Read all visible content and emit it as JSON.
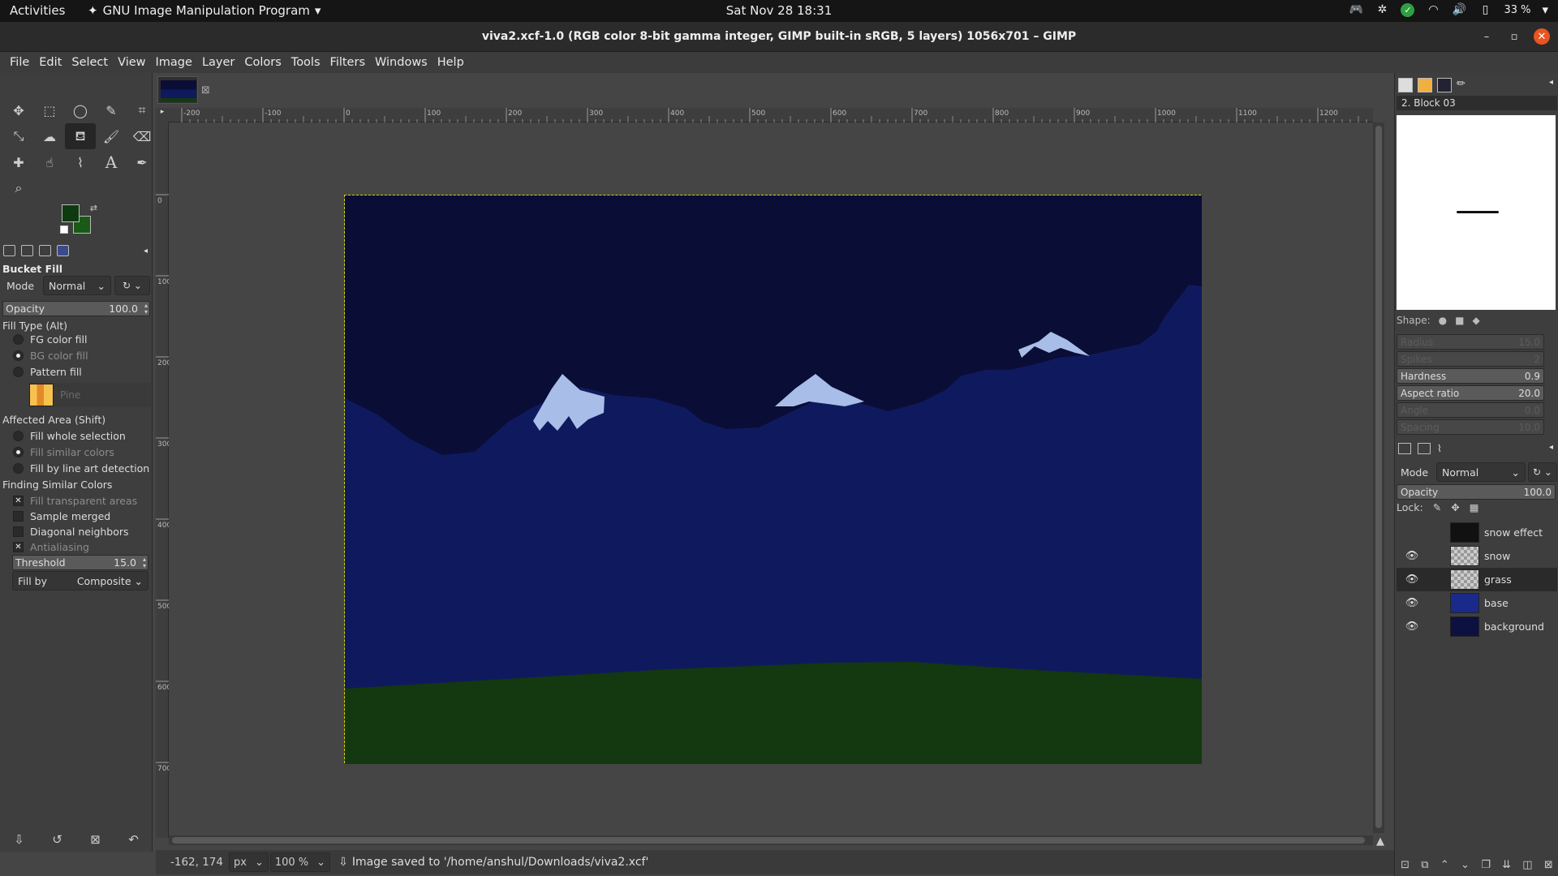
{
  "topbar": {
    "activities": "Activities",
    "app_name": "GNU Image Manipulation Program",
    "clock": "Sat Nov 28  18:31",
    "battery": "33 %"
  },
  "window": {
    "title": "viva2.xcf-1.0 (RGB color 8-bit gamma integer, GIMP built-in sRGB, 5 layers) 1056x701 – GIMP"
  },
  "menu": [
    "File",
    "Edit",
    "Select",
    "View",
    "Image",
    "Layer",
    "Colors",
    "Tools",
    "Filters",
    "Windows",
    "Help"
  ],
  "toolbox": {
    "tools": [
      "move-icon",
      "rect-select-icon",
      "lasso-icon",
      "fuzzy-select-icon",
      "crop-icon",
      "transform-icon",
      "warp-icon",
      "bucket-fill-icon",
      "paintbrush-icon",
      "eraser-icon",
      "heal-icon",
      "smudge-icon",
      "paths-icon",
      "text-icon",
      "color-picker-icon",
      "zoom-icon"
    ],
    "fg_color": "#0e3a10",
    "bg_color": "#1a5a18"
  },
  "tool_options": {
    "title": "Bucket Fill",
    "mode_label": "Mode",
    "mode_value": "Normal",
    "opacity_label": "Opacity",
    "opacity_value": "100.0",
    "fill_type_label": "Fill Type  (Alt)",
    "fill_types": [
      "FG color fill",
      "BG color fill",
      "Pattern fill"
    ],
    "pattern_name": "Pine",
    "affected_area_label": "Affected Area  (Shift)",
    "affected_areas": [
      "Fill whole selection",
      "Fill similar colors",
      "Fill by line art detection"
    ],
    "finding_label": "Finding Similar Colors",
    "checks": [
      "Fill transparent areas",
      "Sample merged",
      "Diagonal neighbors",
      "Antialiasing"
    ],
    "threshold_label": "Threshold",
    "threshold_value": "15.0",
    "fill_by_label": "Fill by",
    "fill_by_value": "Composite"
  },
  "rulers": {
    "h_ticks": [
      "-200",
      "-100",
      "0",
      "100",
      "200",
      "300",
      "400",
      "500",
      "600",
      "700",
      "800",
      "900",
      "1000",
      "1100",
      "1200"
    ],
    "v_ticks": [
      "0",
      "100",
      "200",
      "300",
      "400",
      "500",
      "600",
      "700"
    ]
  },
  "status": {
    "coords": "-162, 174",
    "unit": "px",
    "zoom": "100 %",
    "message": "Image saved to '/home/anshul/Downloads/viva2.xcf'"
  },
  "brushes": {
    "brush_name": "2. Block 03",
    "shape_label": "Shape:",
    "sliders": [
      {
        "label": "Radius",
        "value": "15.0",
        "faded": true
      },
      {
        "label": "Spikes",
        "value": "2",
        "faded": true
      },
      {
        "label": "Hardness",
        "value": "0.9",
        "faded": false
      },
      {
        "label": "Aspect ratio",
        "value": "20.0",
        "faded": false
      },
      {
        "label": "Angle",
        "value": "0.0",
        "faded": true
      },
      {
        "label": "Spacing",
        "value": "10.0",
        "faded": true
      }
    ]
  },
  "layers": {
    "mode_label": "Mode",
    "mode_value": "Normal",
    "opacity_label": "Opacity",
    "opacity_value": "100.0",
    "lock_label": "Lock:",
    "items": [
      {
        "name": "snow effect",
        "visible": false,
        "selected": false,
        "thumb": "#111111"
      },
      {
        "name": "snow",
        "visible": true,
        "selected": false,
        "thumb": "checker"
      },
      {
        "name": "grass",
        "visible": true,
        "selected": true,
        "thumb": "checker"
      },
      {
        "name": "base",
        "visible": true,
        "selected": false,
        "thumb": "#1a2a8a"
      },
      {
        "name": "background",
        "visible": true,
        "selected": false,
        "thumb": "#0c1140"
      }
    ]
  },
  "image": {
    "sky_color": "#0a0d35",
    "mountain_color": "#0f1a5e",
    "snow_color": "#a8bde8",
    "grass_color": "#14380f"
  }
}
